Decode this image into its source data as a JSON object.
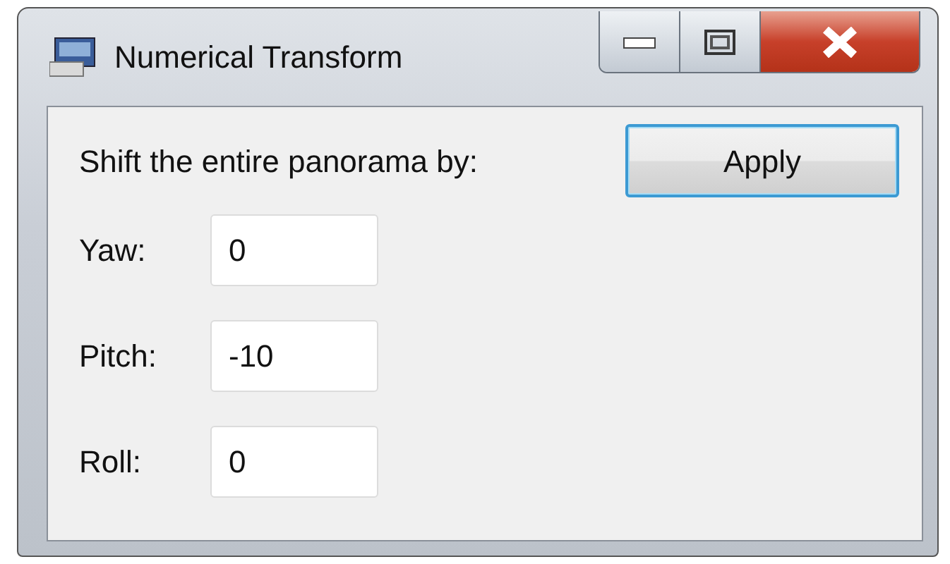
{
  "window": {
    "title": "Numerical Transform"
  },
  "instruction": "Shift the entire panorama by:",
  "apply_button": {
    "label": "Apply",
    "focused": true
  },
  "fields": [
    {
      "label": "Yaw:",
      "value": "0"
    },
    {
      "label": "Pitch:",
      "value": "-10"
    },
    {
      "label": "Roll:",
      "value": "0"
    }
  ]
}
